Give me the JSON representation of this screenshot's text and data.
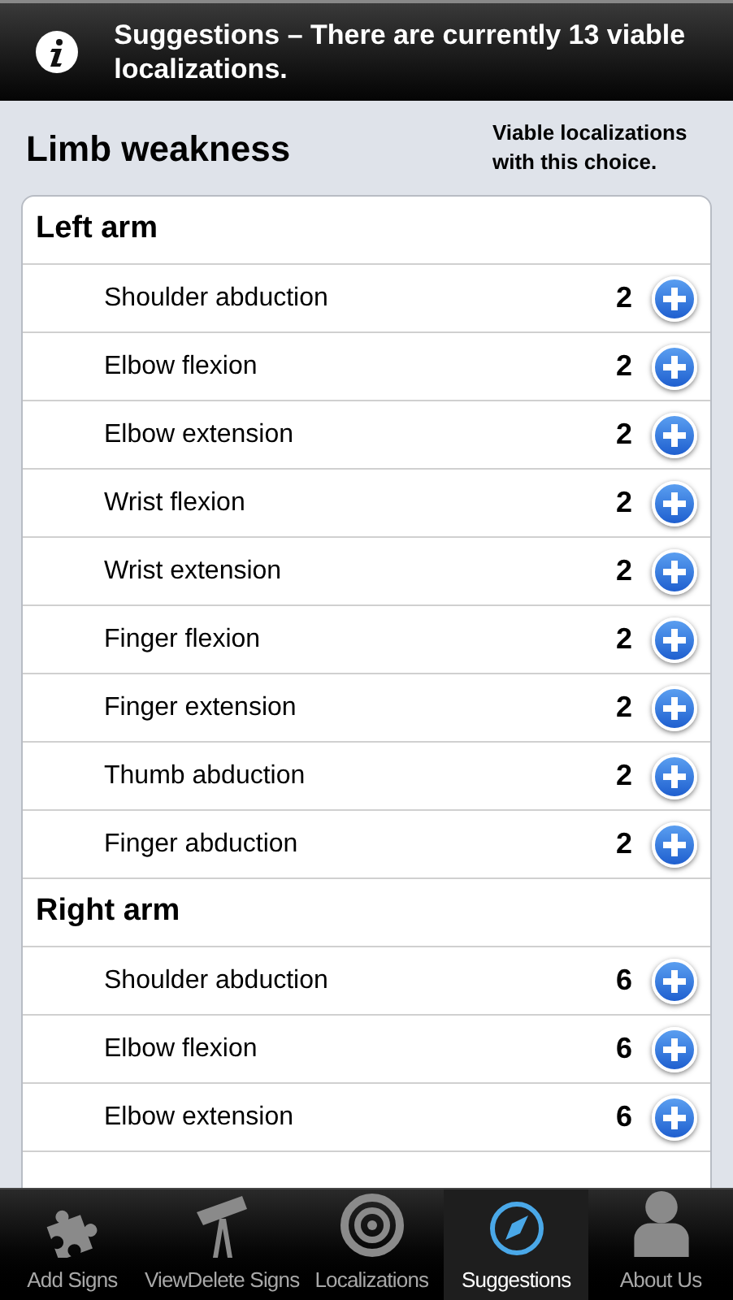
{
  "banner": {
    "text": "Suggestions – There are currently 13 viable localizations."
  },
  "title": "Limb weakness",
  "hint": "Viable localizations with this choice.",
  "sections": [
    {
      "title": "Left arm",
      "rows": [
        {
          "label": "Shoulder abduction",
          "count": "2"
        },
        {
          "label": "Elbow flexion",
          "count": "2"
        },
        {
          "label": "Elbow extension",
          "count": "2"
        },
        {
          "label": "Wrist flexion",
          "count": "2"
        },
        {
          "label": "Wrist extension",
          "count": "2"
        },
        {
          "label": "Finger flexion",
          "count": "2"
        },
        {
          "label": "Finger extension",
          "count": "2"
        },
        {
          "label": "Thumb abduction",
          "count": "2"
        },
        {
          "label": "Finger abduction",
          "count": "2"
        }
      ]
    },
    {
      "title": "Right arm",
      "rows": [
        {
          "label": "Shoulder abduction",
          "count": "6"
        },
        {
          "label": "Elbow flexion",
          "count": "6"
        },
        {
          "label": "Elbow extension",
          "count": "6"
        }
      ]
    }
  ],
  "tabs": [
    {
      "label": "Add Signs",
      "kind": "puzzle",
      "selected": false
    },
    {
      "label": "ViewDelete Signs",
      "kind": "telescope",
      "selected": false
    },
    {
      "label": "Localizations",
      "kind": "target",
      "selected": false
    },
    {
      "label": "Suggestions",
      "kind": "compass",
      "selected": true
    },
    {
      "label": "About Us",
      "kind": "person",
      "selected": false
    }
  ]
}
